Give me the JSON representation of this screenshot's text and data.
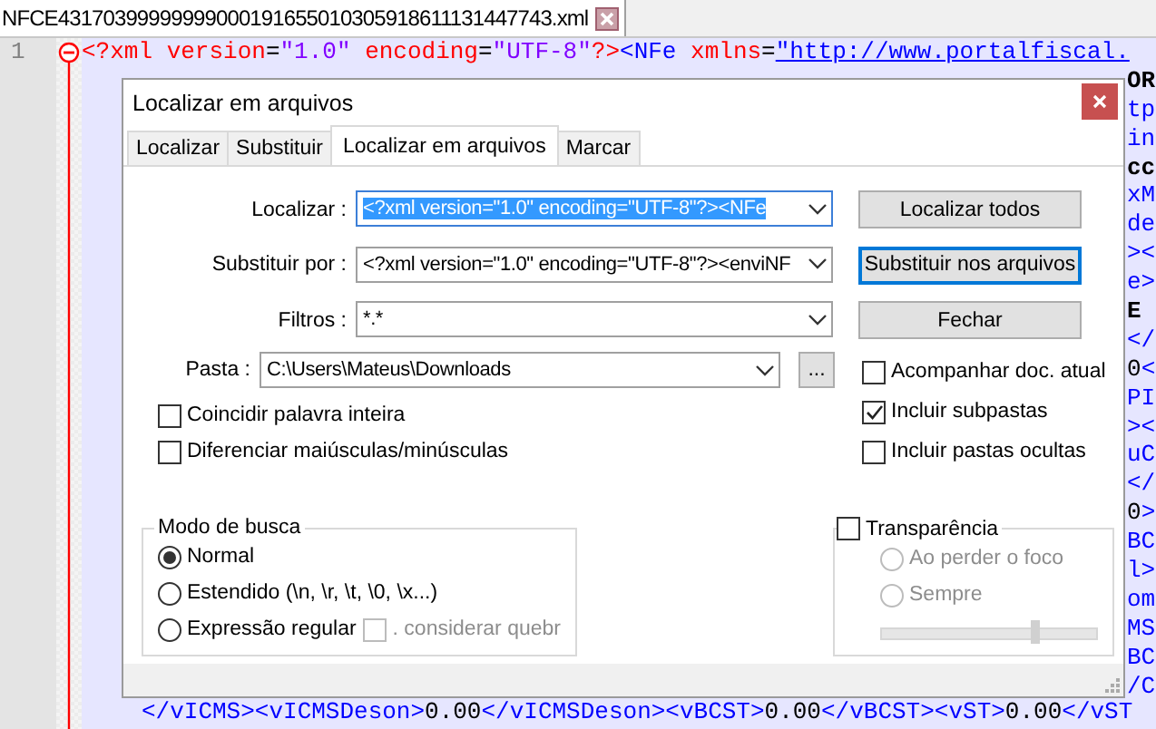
{
  "file_tab": {
    "title": "NFCE43170399999999000191655010305918611131447743.xml",
    "selected": true
  },
  "editor": {
    "line_numbers": [
      "1"
    ],
    "lines": [
      {
        "kind": "code",
        "tokens": [
          {
            "kind": "pi",
            "text": "<?xml"
          },
          {
            "kind": "attr",
            "text": " version"
          },
          {
            "kind": "op",
            "text": "="
          },
          {
            "kind": "value",
            "text": "\"1.0\""
          },
          {
            "kind": "attr",
            "text": " encoding"
          },
          {
            "kind": "op",
            "text": "="
          },
          {
            "kind": "value",
            "text": "\"UTF-8\""
          },
          {
            "kind": "pi",
            "text": "?>"
          },
          {
            "kind": "tag",
            "text": "<NFe"
          },
          {
            "kind": "attr",
            "text": " xmlns"
          },
          {
            "kind": "op",
            "text": "="
          },
          {
            "kind": "link",
            "text": "\"http://www.portalfiscal."
          }
        ]
      },
      {
        "kind": "fragment",
        "tokens": [
          {
            "kind": "strong",
            "text": "OR"
          }
        ]
      },
      {
        "kind": "fragment",
        "tokens": [
          {
            "kind": "tag",
            "text": "tp"
          }
        ]
      },
      {
        "kind": "fragment",
        "tokens": [
          {
            "kind": "tag",
            "text": "in"
          }
        ]
      },
      {
        "kind": "fragment",
        "tokens": [
          {
            "kind": "strong",
            "text": "cc"
          }
        ]
      },
      {
        "kind": "fragment",
        "tokens": [
          {
            "kind": "tag",
            "text": "xM"
          }
        ]
      },
      {
        "kind": "fragment",
        "tokens": [
          {
            "kind": "tag",
            "text": "de"
          }
        ]
      },
      {
        "kind": "fragment",
        "tokens": [
          {
            "kind": "tag",
            "text": "><"
          }
        ]
      },
      {
        "kind": "fragment",
        "tokens": [
          {
            "kind": "tag",
            "text": "e>"
          }
        ]
      },
      {
        "kind": "fragment",
        "tokens": [
          {
            "kind": "strong",
            "text": "E"
          }
        ]
      },
      {
        "kind": "fragment",
        "tokens": [
          {
            "kind": "tag",
            "text": "</"
          }
        ]
      },
      {
        "kind": "fragment",
        "tokens": [
          {
            "kind": "text",
            "text": "0"
          },
          {
            "kind": "tag",
            "text": "<"
          }
        ]
      },
      {
        "kind": "fragment",
        "tokens": [
          {
            "kind": "tag",
            "text": "PI"
          }
        ]
      },
      {
        "kind": "fragment",
        "tokens": [
          {
            "kind": "tag",
            "text": "><"
          }
        ]
      },
      {
        "kind": "fragment",
        "tokens": [
          {
            "kind": "tag",
            "text": "uC"
          }
        ]
      },
      {
        "kind": "fragment",
        "tokens": [
          {
            "kind": "tag",
            "text": "</"
          }
        ]
      },
      {
        "kind": "fragment",
        "tokens": [
          {
            "kind": "text",
            "text": "0"
          },
          {
            "kind": "tag",
            "text": ">"
          }
        ]
      },
      {
        "kind": "fragment",
        "tokens": [
          {
            "kind": "tag",
            "text": "BC"
          }
        ]
      },
      {
        "kind": "fragment",
        "tokens": [
          {
            "kind": "tag",
            "text": "l>"
          }
        ]
      },
      {
        "kind": "fragment",
        "tokens": [
          {
            "kind": "tag",
            "text": "om"
          }
        ]
      },
      {
        "kind": "fragment",
        "tokens": [
          {
            "kind": "tag",
            "text": "MS"
          }
        ]
      },
      {
        "kind": "fragment",
        "tokens": [
          {
            "kind": "tag",
            "text": "BC"
          }
        ]
      },
      {
        "kind": "fragment",
        "tokens": [
          {
            "kind": "tag",
            "text": "/C"
          }
        ]
      },
      {
        "kind": "code",
        "tokens": [
          {
            "kind": "tag",
            "text": "</vICMS><vICMSDeson>"
          },
          {
            "kind": "text",
            "text": "0.00"
          },
          {
            "kind": "tag",
            "text": "</vICMSDeson><vBCST>"
          },
          {
            "kind": "text",
            "text": "0.00"
          },
          {
            "kind": "tag",
            "text": "</vBCST><vST>"
          },
          {
            "kind": "text",
            "text": "0.00"
          },
          {
            "kind": "tag",
            "text": "</vST"
          }
        ]
      }
    ]
  },
  "dialog": {
    "title": "Localizar em arquivos",
    "tabs": [
      {
        "label": "Localizar",
        "selected": false
      },
      {
        "label": "Substituir",
        "selected": false
      },
      {
        "label": "Localizar em arquivos",
        "selected": true
      },
      {
        "label": "Marcar",
        "selected": false
      }
    ],
    "fields": [
      {
        "label": "Localizar :",
        "value": "<?xml version=\"1.0\" encoding=\"UTF-8\"?><NFe",
        "selected": true
      },
      {
        "label": "Substituir por :",
        "value": "<?xml version=\"1.0\" encoding=\"UTF-8\"?><enviNF",
        "selected": false
      },
      {
        "label": "Filtros :",
        "value": "*.*",
        "selected": false
      }
    ],
    "buttons": [
      {
        "label": "Localizar todos",
        "focused": false
      },
      {
        "label": "Substituir nos arquivos",
        "focused": true
      },
      {
        "label": "Fechar",
        "focused": false
      }
    ],
    "folder": {
      "label": "Pasta :",
      "value": "C:\\Users\\Mateus\\Downloads",
      "browse": "..."
    },
    "left_options": [
      {
        "label": "Coincidir palavra inteira",
        "checked": false
      },
      {
        "label": "Diferenciar maiúsculas/minúsculas",
        "checked": false
      }
    ],
    "right_options": [
      {
        "label": "Acompanhar doc. atual",
        "checked": false
      },
      {
        "label": "Incluir subpastas",
        "checked": true
      },
      {
        "label": "Incluir pastas ocultas",
        "checked": false
      }
    ],
    "search_mode": {
      "title": "Modo de busca",
      "options": [
        {
          "label": "Normal",
          "selected": true
        },
        {
          "label": "Estendido  (\\n, \\r, \\t, \\0, \\x...)",
          "selected": false
        },
        {
          "label": "Expressão regular",
          "selected": false
        }
      ],
      "dot_newline": {
        "label": ". considerar quebr",
        "checked": false,
        "disabled": true
      }
    },
    "transparency": {
      "label": "Transparência",
      "checked": false,
      "options": [
        {
          "label": "Ao perder o foco",
          "selected": false
        },
        {
          "label": "Sempre",
          "selected": false
        }
      ],
      "level": 0.71
    }
  }
}
